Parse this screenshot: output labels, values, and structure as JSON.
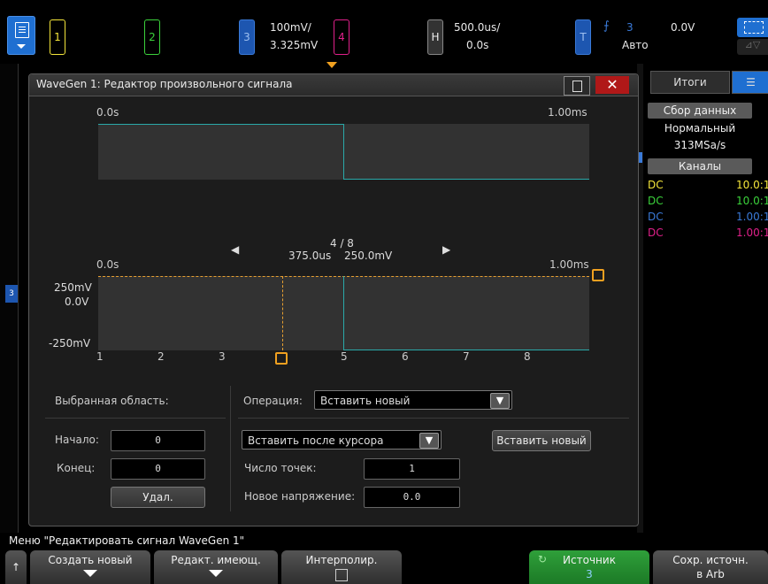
{
  "top": {
    "ch1": "1",
    "ch2": "2",
    "ch3": "3",
    "ch4": "4",
    "ch4_scale": "100mV/",
    "ch4_offset": "3.325mV",
    "h_label": "H",
    "h_scale": "500.0us/",
    "h_delay": "0.0s",
    "t_label": "T",
    "trig_source": "3",
    "trig_mode": "Авто",
    "trig_level": "0.0V",
    "colors": {
      "ch1": "#f5e63a",
      "ch2": "#3bd23b",
      "ch3": "#3a7ad8",
      "ch4": "#e0208a"
    }
  },
  "dialog": {
    "title": "WaveGen 1: Редактор произвольного сигнала",
    "close": "✕",
    "overview": {
      "t_start": "0.0s",
      "t_end": "1.00ms"
    },
    "nav": {
      "prev": "◀",
      "next": "▶",
      "point": "4 / 8",
      "time": "375.0us",
      "voltage": "250.0mV"
    },
    "detail": {
      "t_start": "0.0s",
      "t_end": "1.00ms",
      "y_top": "250mV",
      "y_mid": "0.0V",
      "y_bot": "-250mV",
      "x_ticks": [
        "1",
        "2",
        "3",
        "4",
        "5",
        "6",
        "7",
        "8"
      ]
    },
    "selection_label": "Выбранная область:",
    "start_label": "Начало:",
    "start_value": "0",
    "end_label": "Конец:",
    "end_value": "0",
    "delete_btn": "Удал.",
    "operation_label": "Операция:",
    "operation_value": "Вставить новый",
    "insert_mode": "Вставить после курсора",
    "insert_btn": "Вставить новый",
    "points_label": "Число точек:",
    "points_value": "1",
    "voltage_label": "Новое напряжение:",
    "voltage_value": "0.0"
  },
  "right_panel": {
    "tab1": "Итоги",
    "acq_header": "Сбор данных",
    "acq_mode": "Нормальный",
    "acq_rate": "313MSa/s",
    "channels_header": "Каналы",
    "rows": [
      {
        "coupling": "DC",
        "probe": "10.0:1"
      },
      {
        "coupling": "DC",
        "probe": "10.0:1"
      },
      {
        "coupling": "DC",
        "probe": "1.00:1"
      },
      {
        "coupling": "DC",
        "probe": "1.00:1"
      }
    ]
  },
  "status": "Меню \"Редактировать сигнал WaveGen 1\"",
  "softkeys": {
    "create": "Создать новый",
    "edit": "Редакт. имеющ.",
    "interp": "Интерполир.",
    "source": "Источник",
    "source_value": "3",
    "save_line1": "Сохр. источн.",
    "save_line2": "в Arb"
  }
}
